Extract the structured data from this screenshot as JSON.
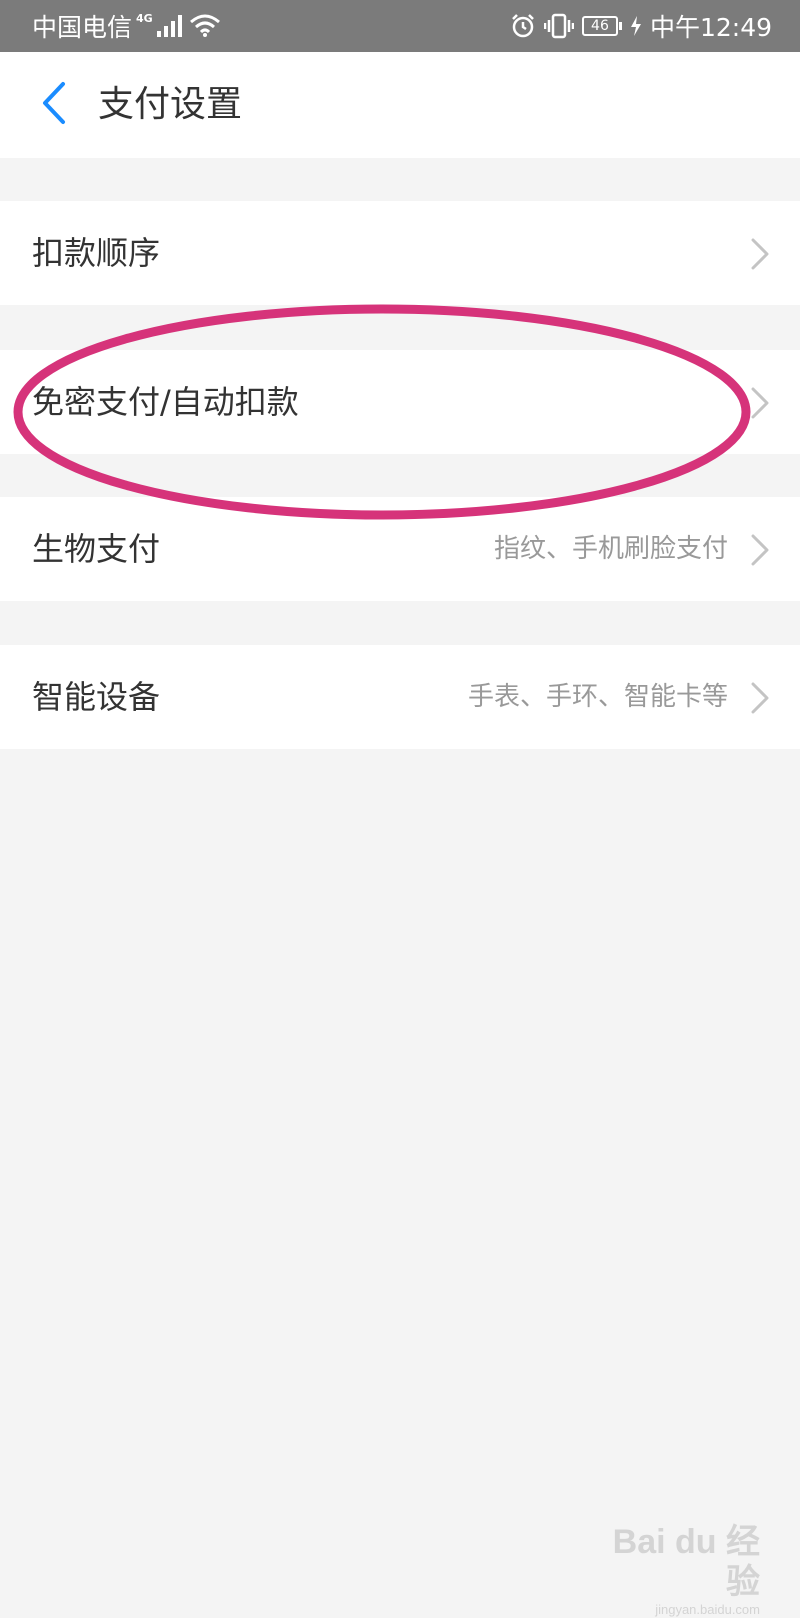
{
  "status_bar": {
    "carrier": "中国电信",
    "network_type": "4G",
    "battery_level": "46",
    "time": "中午12:49",
    "icons": [
      "signal-icon",
      "wifi-icon",
      "alarm-icon",
      "vibrate-icon",
      "battery-icon",
      "charging-icon"
    ]
  },
  "header": {
    "title": "支付设置",
    "back_icon": "chevron-left-icon",
    "accent_color": "#1a8cff"
  },
  "settings": {
    "items": [
      {
        "label": "扣款顺序",
        "detail": ""
      },
      {
        "label": "免密支付/自动扣款",
        "detail": ""
      },
      {
        "label": "生物支付",
        "detail": "指纹、手机刷脸支付"
      },
      {
        "label": "智能设备",
        "detail": "手表、手环、智能卡等"
      }
    ]
  },
  "annotation": {
    "color": "#d6337a"
  },
  "watermark": {
    "logo": "Bai du 经验",
    "url": "jingyan.baidu.com"
  }
}
